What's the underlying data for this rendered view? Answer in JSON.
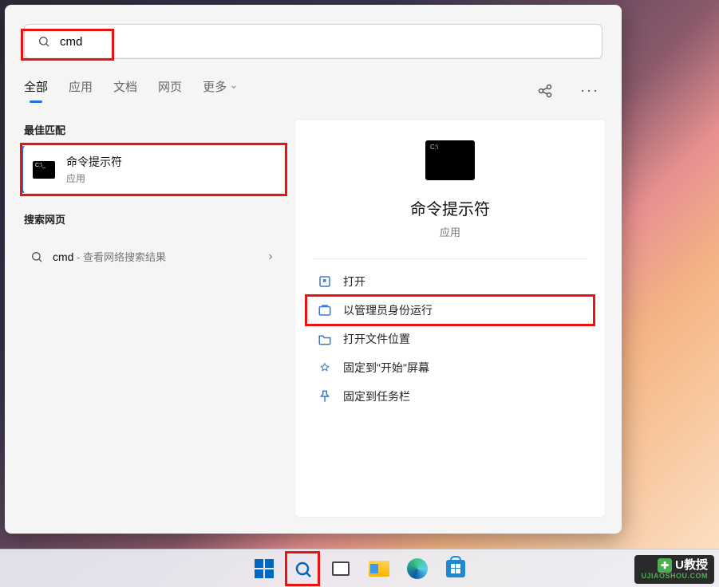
{
  "search": {
    "query": "cmd",
    "placeholder": ""
  },
  "tabs": {
    "all": "全部",
    "apps": "应用",
    "docs": "文档",
    "web": "网页",
    "more": "更多"
  },
  "left": {
    "best_label": "最佳匹配",
    "best_result": {
      "title": "命令提示符",
      "subtitle": "应用"
    },
    "web_label": "搜索网页",
    "web_query": "cmd",
    "web_hint": " - 查看网络搜索结果"
  },
  "preview": {
    "title": "命令提示符",
    "subtitle": "应用",
    "actions": {
      "open": "打开",
      "admin": "以管理员身份运行",
      "location": "打开文件位置",
      "pin_start": "固定到\"开始\"屏幕",
      "pin_taskbar": "固定到任务栏"
    }
  },
  "watermark": {
    "brand": "U教授",
    "url": "UJIAOSHOU.COM"
  }
}
